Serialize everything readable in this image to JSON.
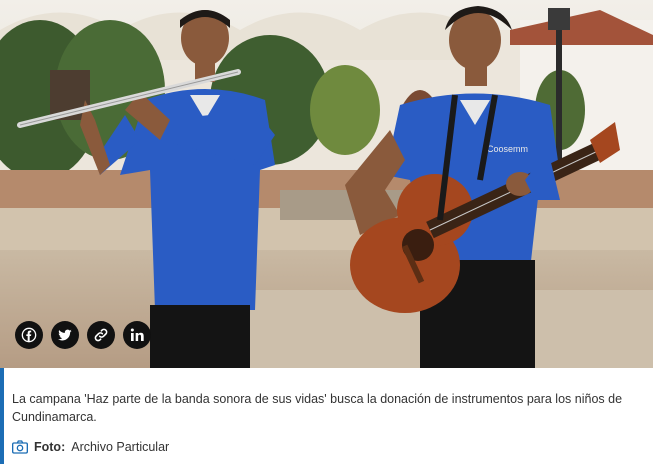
{
  "article": {
    "image_alt": "Dos jóvenes músicos tocando flauta y guitarra",
    "caption": "La campana 'Haz parte de la banda sonora de sus vidas' busca la donación de instrumentos para los niños de Cundinamarca.",
    "credit_label": "Foto:",
    "credit_value": "Archivo Particular"
  },
  "share": {
    "items": [
      {
        "name": "facebook",
        "icon": "facebook-icon"
      },
      {
        "name": "twitter",
        "icon": "twitter-icon"
      },
      {
        "name": "copy-link",
        "icon": "link-icon"
      },
      {
        "name": "linkedin",
        "icon": "linkedin-icon"
      }
    ]
  },
  "colors": {
    "accent": "#1c6db5",
    "share_bg": "#111111",
    "caption_text": "#333333"
  }
}
